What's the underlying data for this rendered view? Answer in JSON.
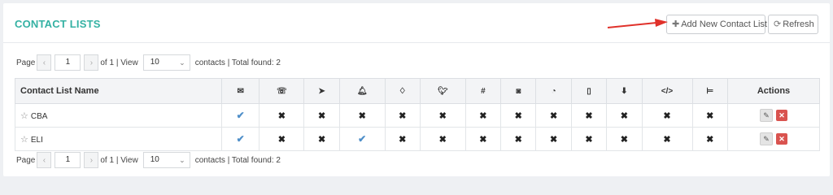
{
  "page": {
    "title": "CONTACT LISTS"
  },
  "toolbar": {
    "add_label": "Add New Contact List",
    "add_icon": "plus-icon",
    "refresh_label": "Refresh",
    "refresh_icon": "refresh-icon"
  },
  "pager": {
    "page_label": "Page",
    "page_value": "1",
    "of_text": "of 1 | View",
    "per_page": "10",
    "contacts_text": "contacts | Total found: 2",
    "prev_glyph": "‹",
    "next_glyph": "›"
  },
  "table": {
    "name_header": "Contact List Name",
    "actions_header": "Actions",
    "channels": [
      "email-icon",
      "phone-icon",
      "telegram-icon",
      "bell-icon",
      "bell-outline-icon",
      "twitter-icon",
      "slack-icon",
      "discord-icon",
      "clock-icon",
      "mobile-icon",
      "download-icon",
      "code-icon",
      "bed-icon"
    ],
    "rows": [
      {
        "name": "CBA",
        "channels": [
          true,
          false,
          false,
          false,
          false,
          false,
          false,
          false,
          false,
          false,
          false,
          false,
          false
        ]
      },
      {
        "name": "ELI",
        "channels": [
          true,
          false,
          false,
          true,
          false,
          false,
          false,
          false,
          false,
          false,
          false,
          false,
          false
        ]
      }
    ]
  },
  "colors": {
    "title": "#34b1a3",
    "check": "#4f8fc9",
    "delete": "#d9534f",
    "arrow": "#e0312a"
  }
}
